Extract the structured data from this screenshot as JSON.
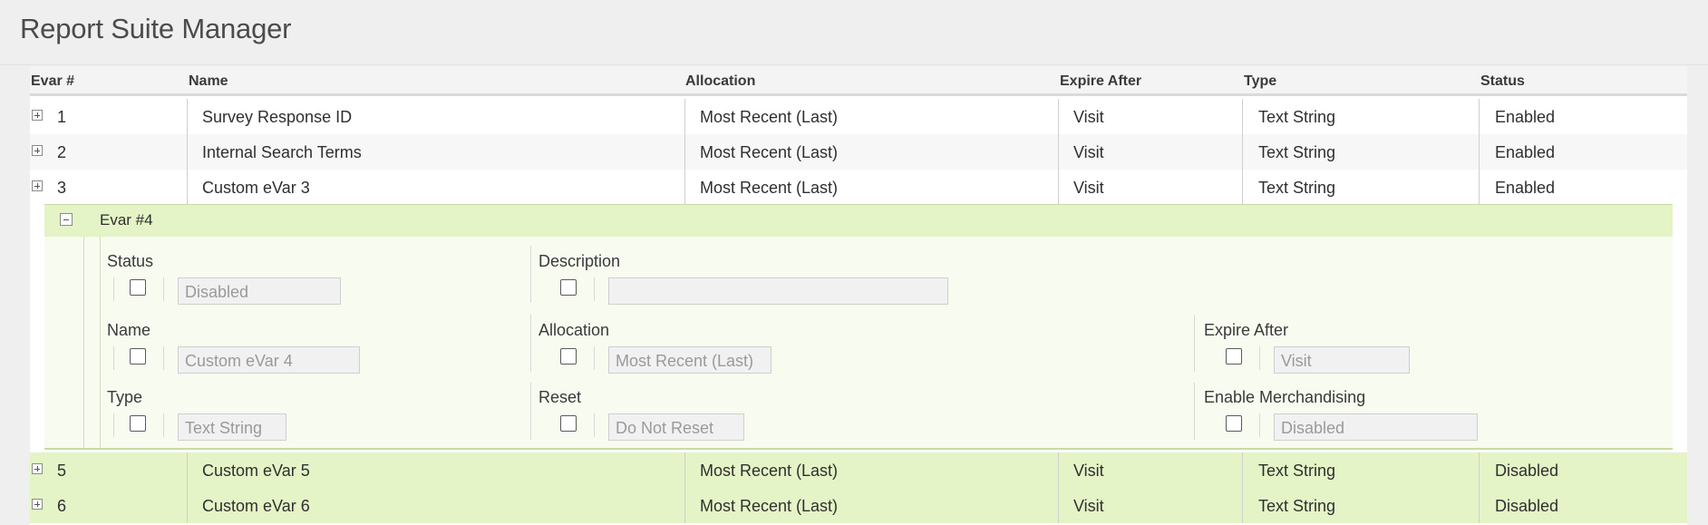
{
  "app": {
    "title": "Report Suite Manager"
  },
  "columns": [
    "Evar #",
    "Name",
    "Allocation",
    "Expire After",
    "Type",
    "Status"
  ],
  "rows_top": [
    {
      "num": "1",
      "name": "Survey Response ID",
      "allocation": "Most Recent (Last)",
      "expire": "Visit",
      "type": "Text String",
      "status": "Enabled"
    },
    {
      "num": "2",
      "name": "Internal Search Terms",
      "allocation": "Most Recent (Last)",
      "expire": "Visit",
      "type": "Text String",
      "status": "Enabled"
    },
    {
      "num": "3",
      "name": "Custom eVar 3",
      "allocation": "Most Recent (Last)",
      "expire": "Visit",
      "type": "Text String",
      "status": "Enabled"
    }
  ],
  "detail": {
    "title": "Evar #4",
    "fields": {
      "status": {
        "label": "Status",
        "value": "Disabled"
      },
      "description": {
        "label": "Description",
        "value": ""
      },
      "name": {
        "label": "Name",
        "value": "Custom eVar 4"
      },
      "allocation": {
        "label": "Allocation",
        "value": "Most Recent (Last)"
      },
      "expire": {
        "label": "Expire After",
        "value": "Visit"
      },
      "type": {
        "label": "Type",
        "value": "Text String"
      },
      "reset": {
        "label": "Reset",
        "value": "Do Not Reset"
      },
      "merch": {
        "label": "Enable Merchandising",
        "value": "Disabled"
      }
    }
  },
  "rows_bottom": [
    {
      "num": "5",
      "name": "Custom eVar 5",
      "allocation": "Most Recent (Last)",
      "expire": "Visit",
      "type": "Text String",
      "status": "Disabled"
    },
    {
      "num": "6",
      "name": "Custom eVar 6",
      "allocation": "Most Recent (Last)",
      "expire": "Visit",
      "type": "Text String",
      "status": "Disabled"
    }
  ],
  "colors": {
    "enabled_row": "#ffffff",
    "disabled_row": "#e4f4c6",
    "detail_bg": "#f8fbf0"
  },
  "icons": {
    "expand": "plus-box-icon",
    "collapse": "minus-box-icon"
  }
}
